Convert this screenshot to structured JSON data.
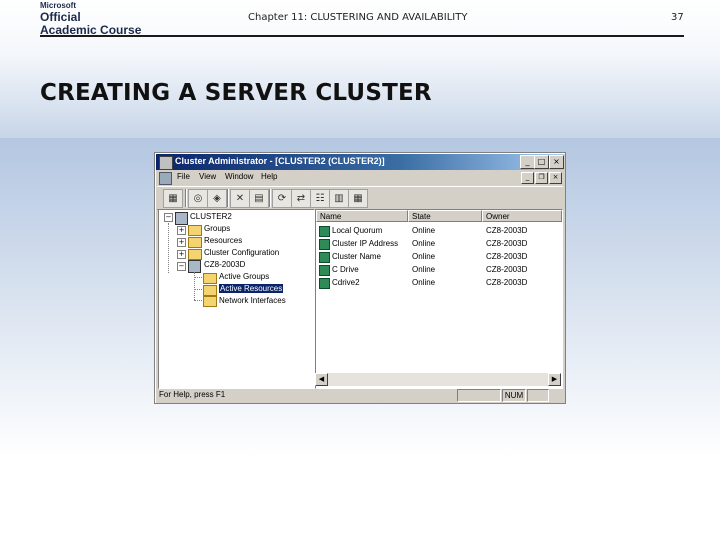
{
  "slide": {
    "logo": {
      "line1": "Microsoft",
      "line2": "Official",
      "line3": "Academic Course"
    },
    "chapter": "Chapter 11: CLUSTERING AND AVAILABILITY",
    "page_number": "37",
    "title": "CREATING A SERVER CLUSTER"
  },
  "window": {
    "title": "Cluster Administrator - [CLUSTER2 (CLUSTER2)]",
    "controls": {
      "minimize": "_",
      "maximize": "□",
      "close": "×"
    },
    "mdi_controls": {
      "minimize": "_",
      "restore": "❐",
      "close": "×"
    },
    "menu": [
      "File",
      "View",
      "Window",
      "Help"
    ],
    "tree": {
      "root": "CLUSTER2",
      "groups": "Groups",
      "resources": "Resources",
      "cluster_configuration": "Cluster Configuration",
      "node": "CZ8-2003D",
      "active_groups": "Active Groups",
      "active_resources": "Active Resources",
      "network_interfaces": "Network Interfaces"
    },
    "list": {
      "columns": [
        "Name",
        "State",
        "Owner"
      ],
      "rows": [
        {
          "name": "Local Quorum",
          "state": "Online",
          "owner": "CZ8-2003D"
        },
        {
          "name": "Cluster IP Address",
          "state": "Online",
          "owner": "CZ8-2003D"
        },
        {
          "name": "Cluster Name",
          "state": "Online",
          "owner": "CZ8-2003D"
        },
        {
          "name": "C Drive",
          "state": "Online",
          "owner": "CZ8-2003D"
        },
        {
          "name": "Cdrive2",
          "state": "Online",
          "owner": "CZ8-2003D"
        }
      ]
    },
    "status": {
      "message": "For Help, press F1",
      "num": "NUM"
    }
  }
}
